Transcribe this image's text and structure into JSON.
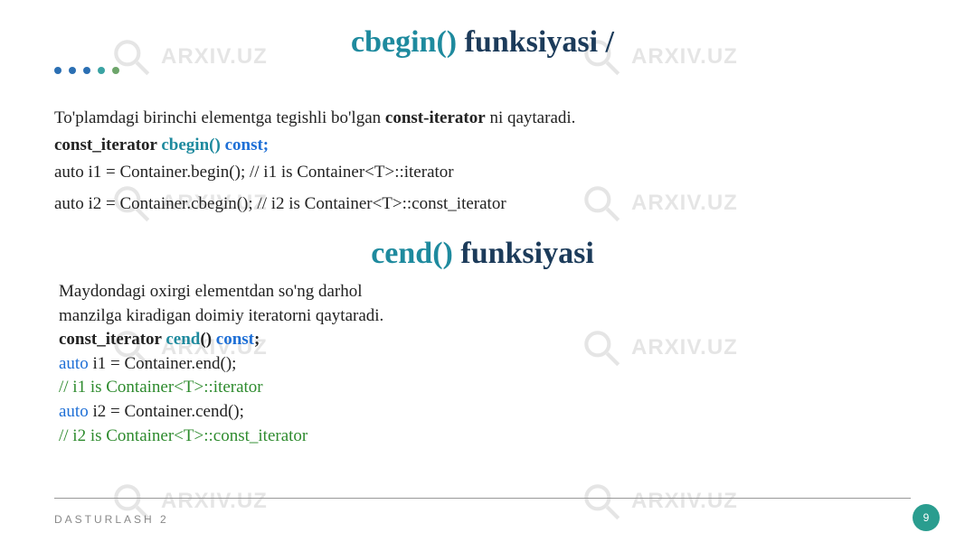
{
  "watermark": {
    "text": "ARXIV.UZ"
  },
  "heading1": {
    "part1": "cbegin()",
    "part2": "funksiyasi /"
  },
  "dots": [
    "#2b6fb3",
    "#2b6fb3",
    "#2b6fb3",
    "#3aa3a3",
    "#6da56a"
  ],
  "section1": {
    "line1_pre": "To'plamdagi birinchi elementga tegishli bo'lgan ",
    "line1_bold": "const-iterator",
    "line1_post": " ni qaytaradi.",
    "line2_bold": "const_iterator ",
    "line2_teal": "cbegin()",
    "line2_blue": " const;",
    "line3": "auto i1 = Container.begin(); // i1 is Container<T>::iterator",
    "line4": "auto i2 = Container.cbegin(); // i2 is Container<T>::const_iterator"
  },
  "heading2": {
    "part1": "cend()",
    "part2": "funksiyasi"
  },
  "section2": {
    "l1": "Maydondagi oxirgi elementdan so'ng darhol",
    "l2": "manzilga kiradigan doimiy iteratorni qaytaradi.",
    "l3_bold": "const_iterator ",
    "l3_teal": "cend",
    "l3_bold2": "() ",
    "l3_blue": "const",
    "l3_bold3": ";",
    "l4_auto": "auto",
    "l4_rest": " i1 = Container.end();",
    "l5": "// i1 is Container<T>::iterator",
    "l6_auto": "auto",
    "l6_rest": " i2 = Container.cend();",
    "l7": "// i2 is Container<T>::const_iterator"
  },
  "footer": {
    "text": "DASTURLASH 2",
    "page": "9"
  }
}
